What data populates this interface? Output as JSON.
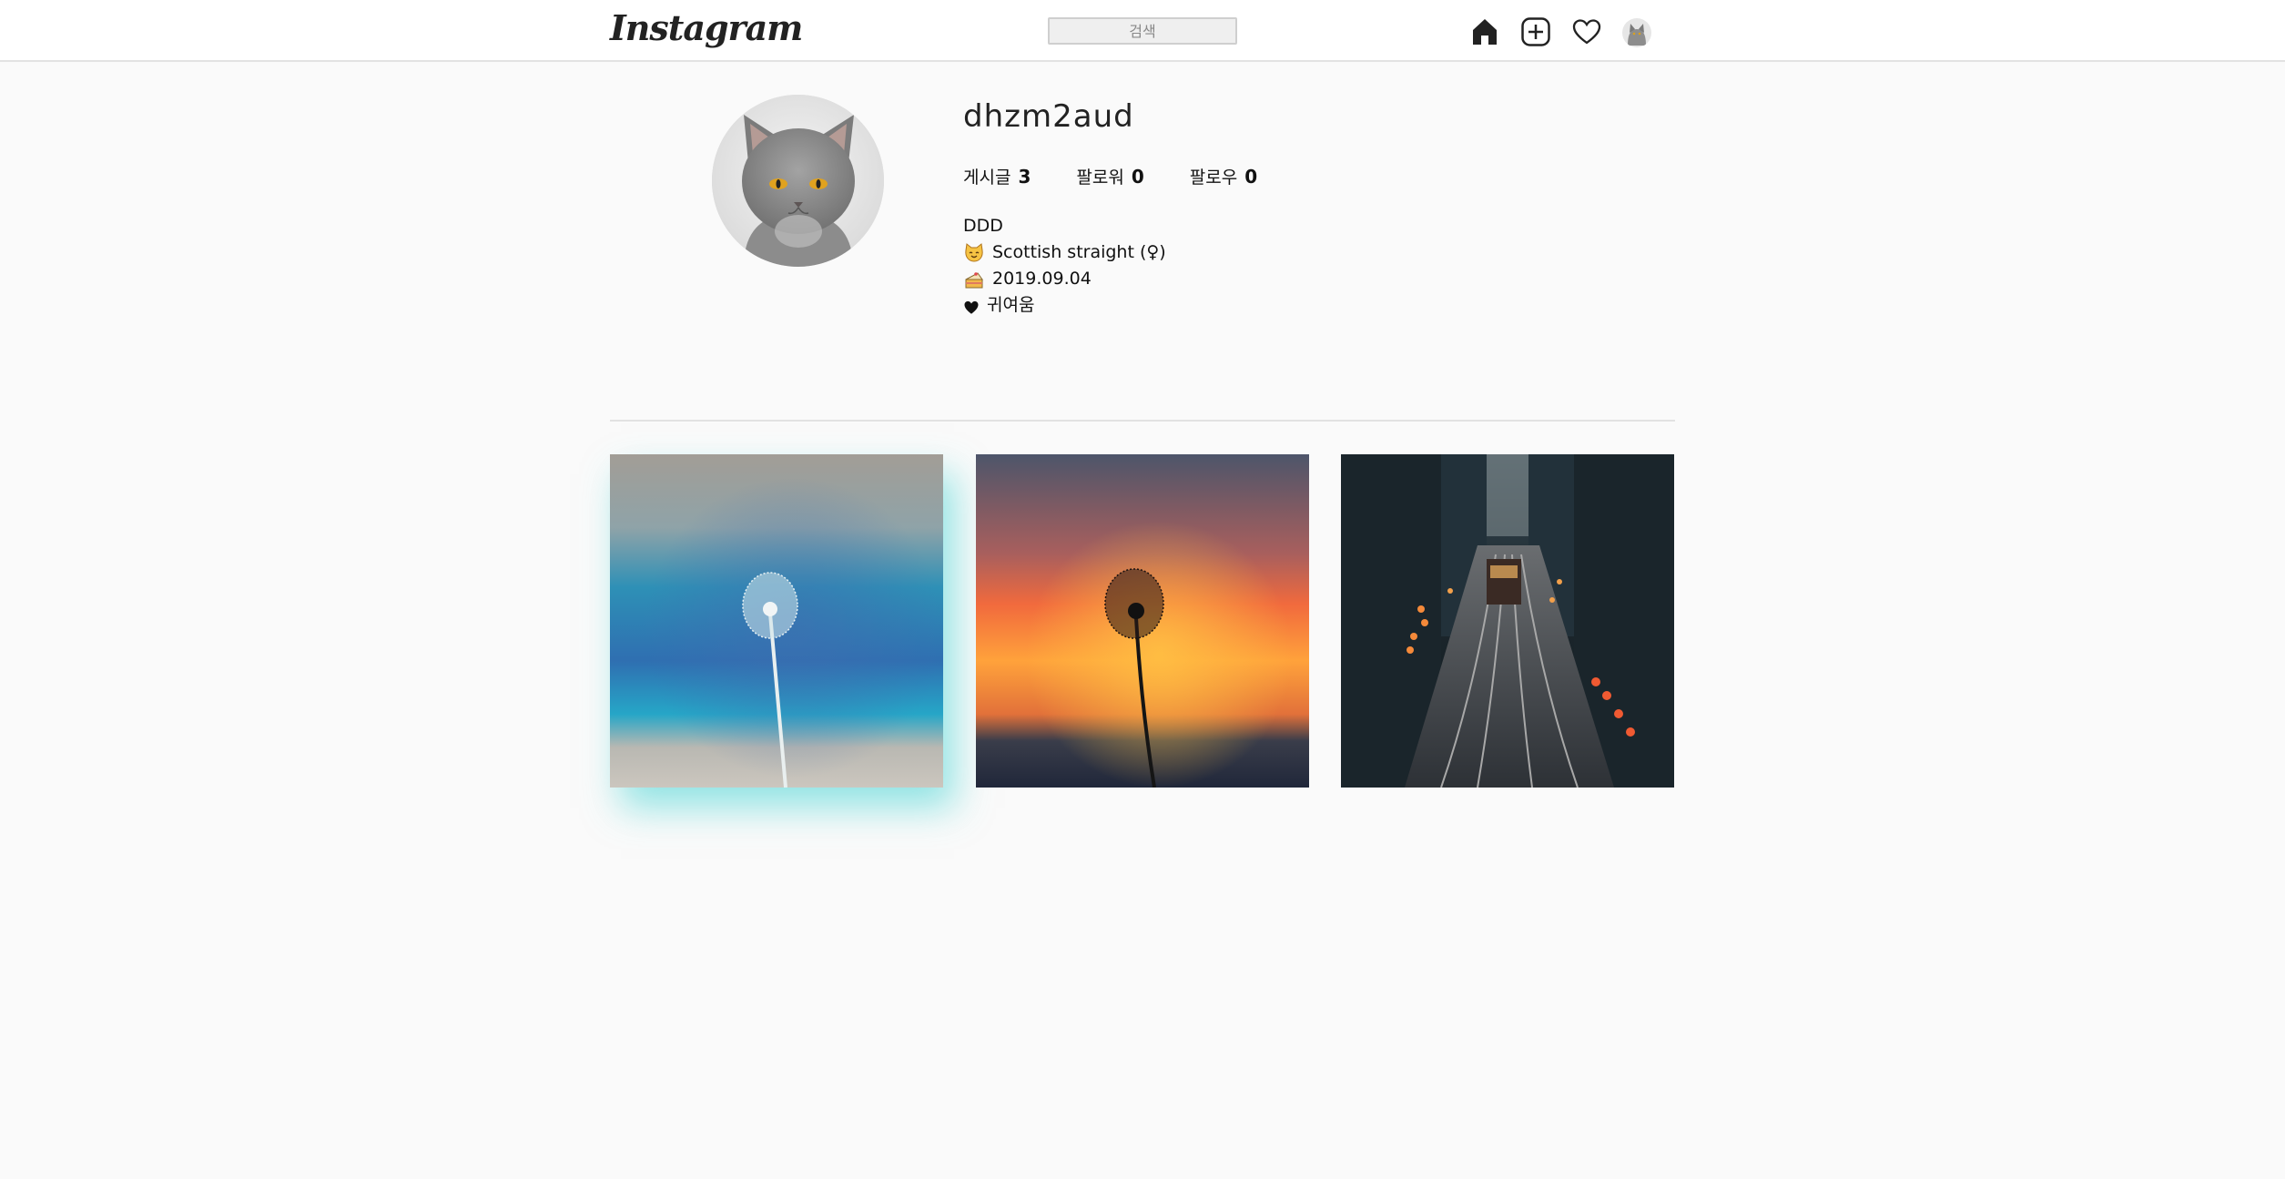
{
  "header": {
    "logo_text": "Instagram",
    "search_placeholder": "검색",
    "icons": [
      "home-icon",
      "add-post-icon",
      "heart-icon",
      "profile-avatar"
    ]
  },
  "profile": {
    "username": "dhzm2aud",
    "stats": [
      {
        "label": "게시글",
        "count": "3"
      },
      {
        "label": "팔로워",
        "count": "0"
      },
      {
        "label": "팔로우",
        "count": "0"
      }
    ],
    "bio": {
      "line1": "DDD",
      "breed": "Scottish straight (♀)",
      "birthday": "2019.09.04",
      "note": "귀여움"
    }
  },
  "posts": [
    {
      "subject": "dandelion-blue"
    },
    {
      "subject": "dandelion-sunset"
    },
    {
      "subject": "city-street-night"
    }
  ],
  "colors": {
    "header_bg": "#ffffff",
    "page_bg": "#fafafa",
    "highlight_glow": "#3cd2d2"
  }
}
